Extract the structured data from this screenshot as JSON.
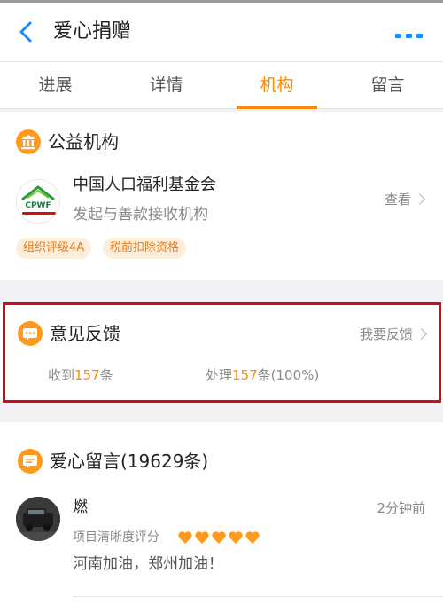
{
  "header": {
    "title": "爱心捐赠",
    "back_icon": "chevron-left-icon",
    "more_icon": "more-dots-icon",
    "accent_color": "#1a8cff"
  },
  "tabs": [
    {
      "label": "进展",
      "active": false
    },
    {
      "label": "详情",
      "active": false
    },
    {
      "label": "机构",
      "active": true
    },
    {
      "label": "留言",
      "active": false
    }
  ],
  "active_tab_color": "#ff8a00",
  "org_section": {
    "title": "公益机构",
    "icon": "institution-icon",
    "org_name": "中国人口福利基金会",
    "org_desc": "发起与善款接收机构",
    "logo_text": "CPWF",
    "view_label": "查看",
    "badges": [
      "组织评级4A",
      "税前扣除资格"
    ]
  },
  "feedback_section": {
    "title": "意见反馈",
    "icon": "chat-bubble-icon",
    "action_label": "我要反馈",
    "received_prefix": "收到",
    "received_count": "157",
    "received_suffix": "条",
    "handled_prefix": "处理",
    "handled_count": "157",
    "handled_suffix": "条(100%)"
  },
  "message_section": {
    "title": "爱心留言(19629条)",
    "icon": "message-icon",
    "messages": [
      {
        "user": "燃",
        "time": "2分钟前",
        "rating_label": "项目清晰度评分",
        "rating": 5,
        "text": "河南加油，郑州加油！"
      }
    ]
  }
}
